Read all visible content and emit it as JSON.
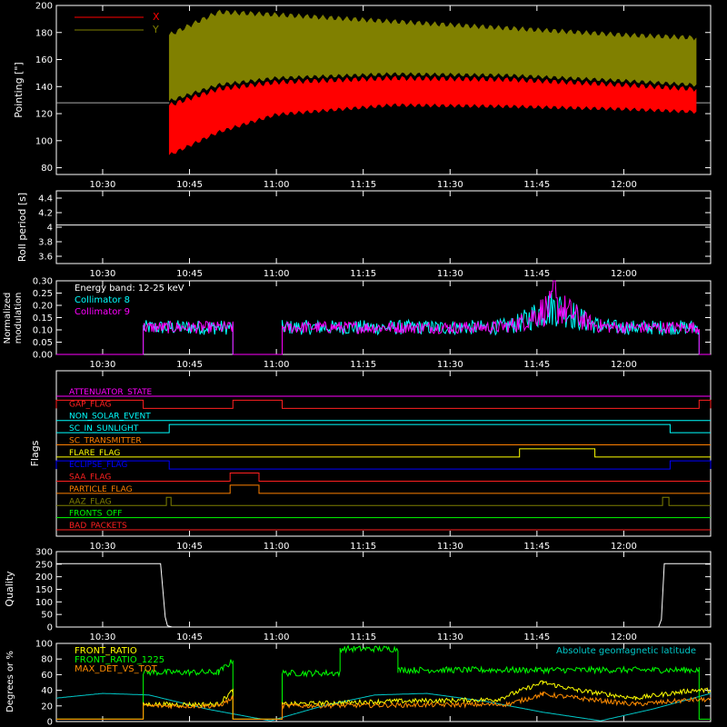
{
  "time_ticks": [
    "10:30",
    "10:45",
    "11:00",
    "11:15",
    "11:30",
    "11:45",
    "12:00"
  ],
  "time_tick_minutes": [
    630,
    645,
    660,
    675,
    690,
    705,
    720
  ],
  "time_range_minutes": [
    622,
    735
  ],
  "colors": {
    "background": "#000000",
    "axes": "#ffffff",
    "x_series": "#ff0000",
    "y_series": "#808000",
    "collimator8": "#00ffff",
    "collimator9": "#ff00ff",
    "front_ratio": "#ffff00",
    "front_ratio_1225": "#00ff00",
    "max_det": "#ff8c00",
    "geomag": "#00c8c8"
  },
  "chart_data": [
    {
      "type": "area",
      "ylabel": "Pointing [\"]",
      "ylim": [
        75,
        200
      ],
      "yticks": [
        80,
        100,
        120,
        140,
        160,
        180,
        200
      ],
      "legend": [
        "X",
        "Y"
      ],
      "legend_placement": "top-left",
      "baseline": 128,
      "activity_start_min": 641.5,
      "activity_end_min": 732.5,
      "series": [
        {
          "name": "X",
          "band": [
            {
              "t": 641.5,
              "lo": 88,
              "hi": 128
            },
            {
              "t": 650,
              "lo": 105,
              "hi": 140
            },
            {
              "t": 660,
              "lo": 118,
              "hi": 145
            },
            {
              "t": 680,
              "lo": 125,
              "hi": 148
            },
            {
              "t": 700,
              "lo": 124,
              "hi": 147
            },
            {
              "t": 720,
              "lo": 122,
              "hi": 143
            },
            {
              "t": 732,
              "lo": 120,
              "hi": 140
            }
          ]
        },
        {
          "name": "Y",
          "band": [
            {
              "t": 641.5,
              "lo": 128,
              "hi": 180
            },
            {
              "t": 650,
              "lo": 140,
              "hi": 197
            },
            {
              "t": 660,
              "lo": 145,
              "hi": 195
            },
            {
              "t": 680,
              "lo": 148,
              "hi": 190
            },
            {
              "t": 700,
              "lo": 147,
              "hi": 185
            },
            {
              "t": 720,
              "lo": 143,
              "hi": 180
            },
            {
              "t": 732,
              "lo": 140,
              "hi": 178
            }
          ]
        }
      ]
    },
    {
      "type": "line",
      "ylabel": "Roll period [s]",
      "ylim": [
        3.5,
        4.5
      ],
      "yticks": [
        3.6,
        3.8,
        4.0,
        4.2,
        4.4
      ],
      "x": [
        622,
        735
      ],
      "values": [
        4.03,
        4.03
      ]
    },
    {
      "type": "line",
      "ylabel": "Normalized modulation",
      "ylim": [
        0,
        0.3
      ],
      "yticks": [
        "0.00",
        "0.05",
        "0.10",
        "0.15",
        "0.20",
        "0.25",
        "0.30"
      ],
      "legend": [
        "Energy band: 12-25 keV",
        "Collimator 8",
        "Collimator 9"
      ],
      "legend_placement": "top-left",
      "active_intervals": [
        [
          637,
          652.5
        ],
        [
          661,
          733
        ]
      ],
      "typical_level": 0.11,
      "peak": {
        "t": 708,
        "value": 0.3
      },
      "series": [
        {
          "name": "Collimator 8",
          "level": 0.11,
          "spread": 0.03
        },
        {
          "name": "Collimator 9",
          "level": 0.11,
          "spread": 0.025
        }
      ]
    },
    {
      "type": "line",
      "ylabel": "Flags",
      "flags": [
        {
          "name": "ATTENUATOR_STATE",
          "color": "#ff00ff",
          "on_intervals": []
        },
        {
          "name": "GAP_FLAG",
          "color": "#ff2020",
          "on_intervals": [
            [
              622,
              637
            ],
            [
              652.5,
              661
            ],
            [
              733,
              735
            ]
          ]
        },
        {
          "name": "NON_SOLAR_EVENT",
          "color": "#00ffff",
          "on_intervals": []
        },
        {
          "name": "SC_IN_SUNLIGHT",
          "color": "#00ffff",
          "on_intervals": [
            [
              641.5,
              728
            ]
          ]
        },
        {
          "name": "SC_TRANSMITTER",
          "color": "#ff8000",
          "on_intervals": []
        },
        {
          "name": "FLARE_FLAG",
          "color": "#ffff00",
          "on_intervals": [
            [
              702,
              715
            ]
          ]
        },
        {
          "name": "ECLIPSE_FLAG",
          "color": "#0000ff",
          "on_intervals": [
            [
              622,
              641.5
            ],
            [
              728,
              735
            ]
          ]
        },
        {
          "name": "SAA_FLAG",
          "color": "#ff2020",
          "on_intervals": [
            [
              652,
              657
            ]
          ]
        },
        {
          "name": "PARTICLE_FLAG",
          "color": "#ff8000",
          "on_intervals": [
            [
              652,
              657
            ]
          ]
        },
        {
          "name": "AAZ_FLAG",
          "color": "#808000",
          "on_intervals": [
            [
              641,
              641.8
            ],
            [
              726.7,
              727.8
            ]
          ]
        },
        {
          "name": "FRONTS_OFF",
          "color": "#00ff00",
          "on_intervals": []
        },
        {
          "name": "BAD_PACKETS",
          "color": "#ff2020",
          "on_intervals": []
        }
      ]
    },
    {
      "type": "line",
      "ylabel": "Quality",
      "ylim": [
        0,
        300
      ],
      "yticks": [
        0,
        50,
        100,
        150,
        200,
        250,
        300
      ],
      "points": [
        [
          622,
          252
        ],
        [
          640,
          252
        ],
        [
          640.8,
          40
        ],
        [
          641.2,
          5
        ],
        [
          642,
          0
        ],
        [
          726,
          0
        ],
        [
          726.5,
          30
        ],
        [
          727,
          252
        ],
        [
          735,
          252
        ]
      ]
    },
    {
      "type": "line",
      "ylabel": "Degrees or %",
      "ylim": [
        0,
        100
      ],
      "yticks": [
        0,
        20,
        40,
        60,
        80,
        100
      ],
      "legend": [
        "FRONT_RATIO",
        "FRONT_RATIO_1225",
        "MAX_DET_VS_TOT",
        "Absolute geomagnetic latitude"
      ],
      "legend_placement": "top-left",
      "series": [
        {
          "name": "FRONT_RATIO",
          "points": [
            [
              622,
              3
            ],
            [
              637,
              3
            ],
            [
              637,
              22
            ],
            [
              650,
              22
            ],
            [
              652.5,
              40
            ],
            [
              652.5,
              3
            ],
            [
              661,
              3
            ],
            [
              661,
              22
            ],
            [
              680,
              26
            ],
            [
              698,
              28
            ],
            [
              706,
              50
            ],
            [
              712,
              40
            ],
            [
              722,
              30
            ],
            [
              732,
              40
            ],
            [
              735,
              40
            ]
          ]
        },
        {
          "name": "FRONT_RATIO_1225",
          "points": [
            [
              622,
              3
            ],
            [
              637,
              3
            ],
            [
              637,
              63
            ],
            [
              650,
              63
            ],
            [
              652.5,
              78
            ],
            [
              652.5,
              3
            ],
            [
              661,
              3
            ],
            [
              661,
              62
            ],
            [
              671,
              62
            ],
            [
              671,
              93
            ],
            [
              681,
              93
            ],
            [
              681,
              66
            ],
            [
              733,
              66
            ],
            [
              733,
              3
            ],
            [
              735,
              3
            ]
          ]
        },
        {
          "name": "MAX_DET_VS_TOT",
          "points": [
            [
              622,
              3
            ],
            [
              637,
              3
            ],
            [
              637,
              20
            ],
            [
              650,
              20
            ],
            [
              652.5,
              30
            ],
            [
              652.5,
              3
            ],
            [
              661,
              3
            ],
            [
              661,
              20
            ],
            [
              700,
              22
            ],
            [
              706,
              35
            ],
            [
              712,
              30
            ],
            [
              722,
              22
            ],
            [
              732,
              28
            ],
            [
              735,
              28
            ]
          ]
        },
        {
          "name": "Absolute geomagnetic latitude",
          "points": [
            [
              622,
              30
            ],
            [
              630,
              36
            ],
            [
              638,
              34
            ],
            [
              648,
              16
            ],
            [
              659,
              1
            ],
            [
              668,
              20
            ],
            [
              677,
              34
            ],
            [
              686,
              36
            ],
            [
              696,
              26
            ],
            [
              706,
              12
            ],
            [
              716,
              1
            ],
            [
              725,
              16
            ],
            [
              735,
              36
            ]
          ]
        }
      ]
    }
  ]
}
